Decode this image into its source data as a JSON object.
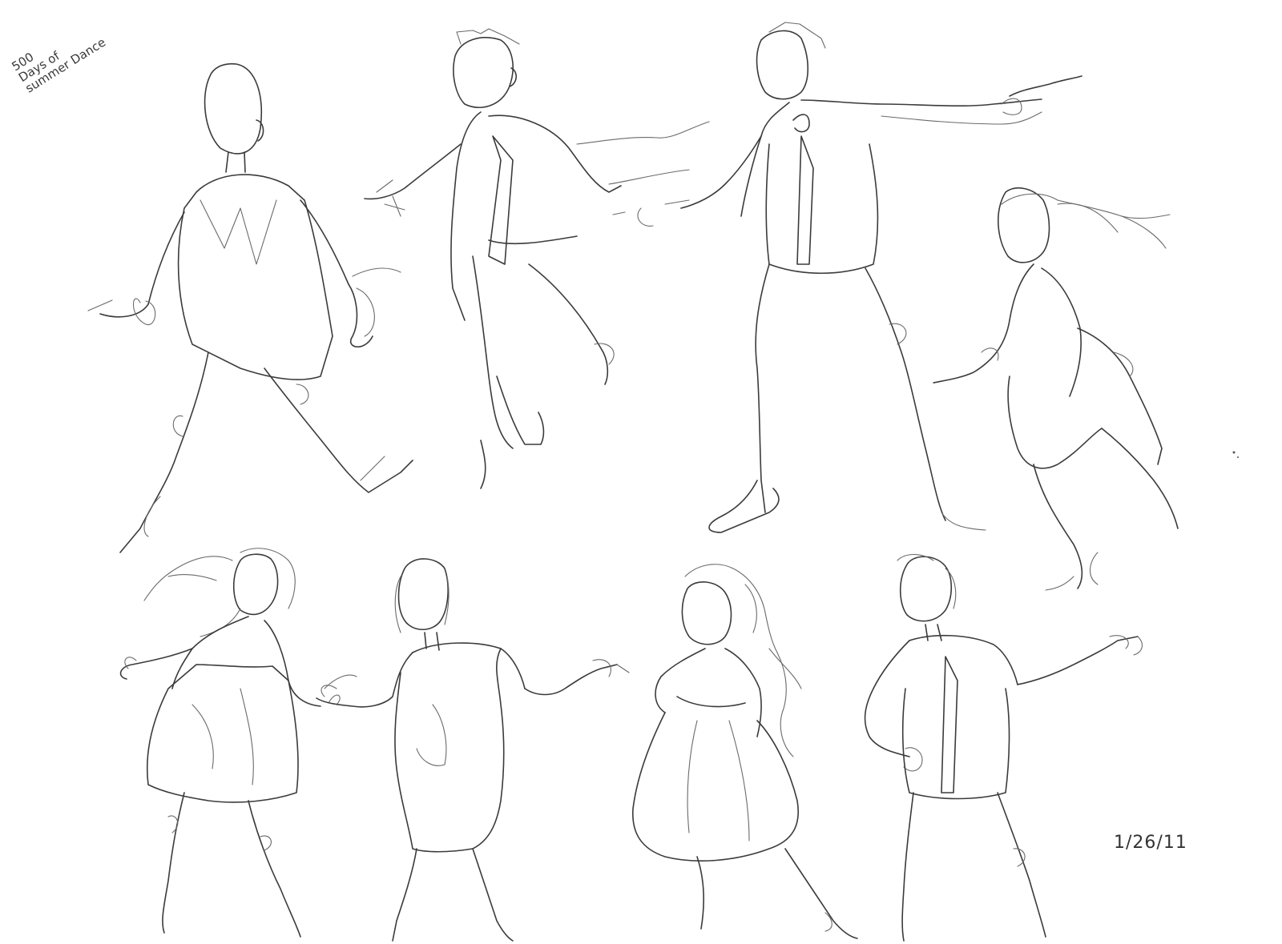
{
  "sheet": {
    "note_lines": [
      "500",
      "Days of",
      "summer Dance"
    ],
    "date": "1/26/11"
  },
  "figures": [
    "figure-suit-back-view",
    "figure-suit-reaching-left",
    "figure-suit-holding-hand",
    "figure-woman-ponytail-leaning",
    "figure-woman-hair-flowing",
    "figure-woman-back-view",
    "figure-woman-twirling-skirt",
    "figure-man-hand-on-hip"
  ]
}
